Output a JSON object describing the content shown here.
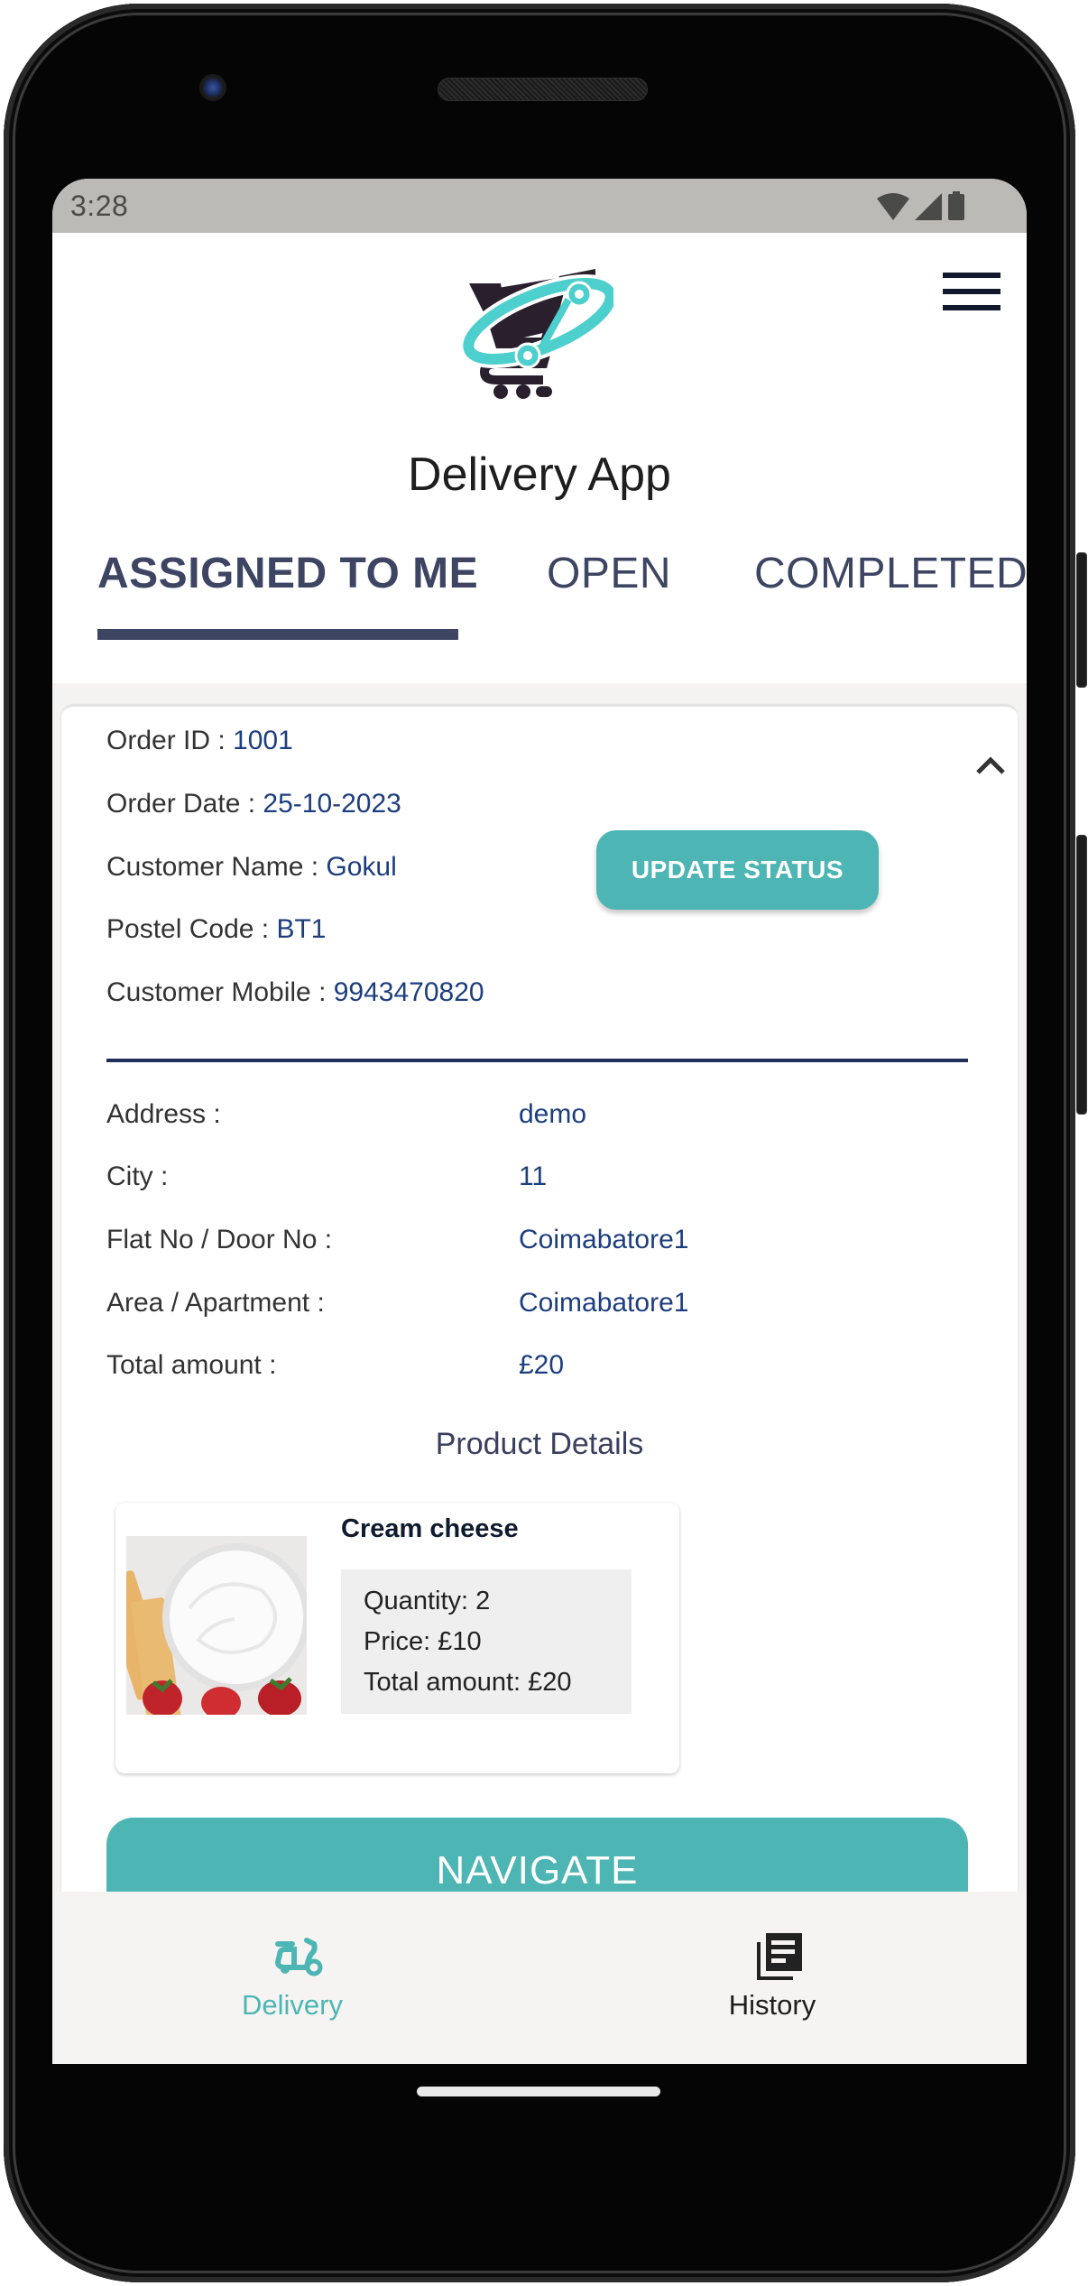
{
  "status_bar": {
    "time": "3:28",
    "icons": [
      "wifi-icon",
      "cell-signal-icon",
      "battery-icon"
    ]
  },
  "header": {
    "logo": "shopping-cart-logo",
    "title": "Delivery App",
    "menu_icon": "hamburger-menu-icon"
  },
  "tabs": [
    {
      "label": "ASSIGNED TO ME",
      "active": true
    },
    {
      "label": "OPEN",
      "active": false
    },
    {
      "label": "COMPLETED",
      "active": false
    }
  ],
  "order": {
    "fields": [
      {
        "label": "Order ID : ",
        "value": "1001"
      },
      {
        "label": "Order Date : ",
        "value": "25-10-2023"
      },
      {
        "label": "Customer Name : ",
        "value": "Gokul"
      },
      {
        "label": "Postel Code : ",
        "value": "BT1"
      },
      {
        "label": "Customer Mobile : ",
        "value": "9943470820"
      }
    ],
    "update_status_label": "UPDATE STATUS",
    "collapse_icon": "chevron-up-icon",
    "address_fields": [
      {
        "label": "Address :",
        "value": "demo"
      },
      {
        "label": "City :",
        "value": "11"
      },
      {
        "label": "Flat No / Door No :",
        "value": "Coimabatore1"
      },
      {
        "label": "Area / Apartment :",
        "value": "Coimabatore1"
      },
      {
        "label": "Total amount :",
        "value": "£20"
      }
    ],
    "product_heading": "Product Details",
    "products": [
      {
        "name": "Cream cheese",
        "image": "cream-cheese-photo",
        "quantity": "Quantity: 2",
        "price": "Price: £10",
        "total": "Total amount: £20"
      }
    ],
    "navigate_label": "NAVIGATE"
  },
  "bottom_nav": [
    {
      "label": "Delivery",
      "icon": "scooter-icon",
      "active": true
    },
    {
      "label": "History",
      "icon": "history-icon",
      "active": false
    }
  ],
  "colors": {
    "accent": "#4db6b4",
    "tab_text": "#3d4563",
    "value_text": "#1d3e7e",
    "divider": "#1f2f57",
    "status_bar": "#bbbab6"
  }
}
